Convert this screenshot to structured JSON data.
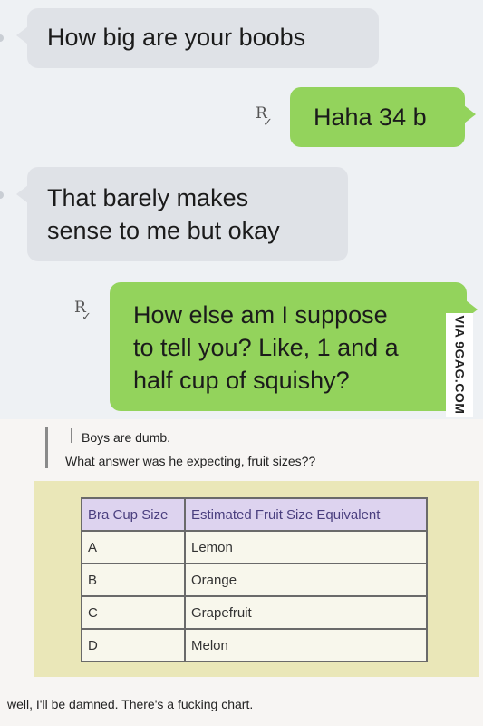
{
  "messages": [
    {
      "direction": "incoming",
      "text": "How big are your boobs"
    },
    {
      "direction": "outgoing",
      "text": "Haha 34 b",
      "receipt": "R"
    },
    {
      "direction": "incoming",
      "lines": [
        "That barely makes",
        "sense to me but okay"
      ]
    },
    {
      "direction": "outgoing",
      "lines": [
        "How else am I suppose",
        "to tell you? Like, 1 and a",
        "half cup of squishy?"
      ],
      "receipt": "R"
    }
  ],
  "watermark": "VIA 9GAG.COM",
  "post": {
    "quote": "Boys are dumb.",
    "reply": "What answer was he expecting, fruit sizes??",
    "table": {
      "headers": [
        "Bra Cup Size",
        "Estimated Fruit Size Equivalent"
      ],
      "rows": [
        [
          "A",
          "Lemon"
        ],
        [
          "B",
          "Orange"
        ],
        [
          "C",
          "Grapefruit"
        ],
        [
          "D",
          "Melon"
        ]
      ]
    },
    "footer": "well, I'll be damned. There's a fucking chart."
  },
  "colors": {
    "incoming_bubble": "#dfe2e7",
    "outgoing_bubble": "#93d35c",
    "table_header": "#ddd3ef",
    "chart_background": "#eae7b8"
  }
}
